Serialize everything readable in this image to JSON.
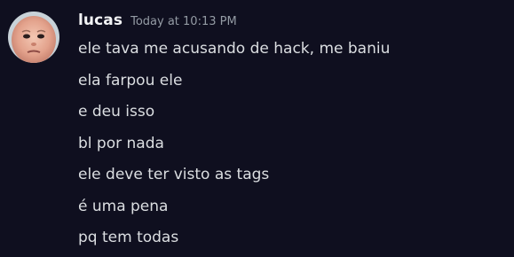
{
  "message": {
    "author": "lucas",
    "timestamp": "Today at 10:13 PM",
    "lines": [
      "ele tava me acusando de hack, me baniu",
      "ela farpou ele",
      "e deu isso",
      "bl por nada",
      "ele deve ter visto as tags",
      "é uma pena",
      "pq tem todas"
    ]
  },
  "colors": {
    "background": "#0f0f1f",
    "username": "#f2f3f5",
    "timestamp": "#949ba4",
    "text": "#dbdee1"
  },
  "icons": {
    "avatar": "user-avatar-photo"
  }
}
